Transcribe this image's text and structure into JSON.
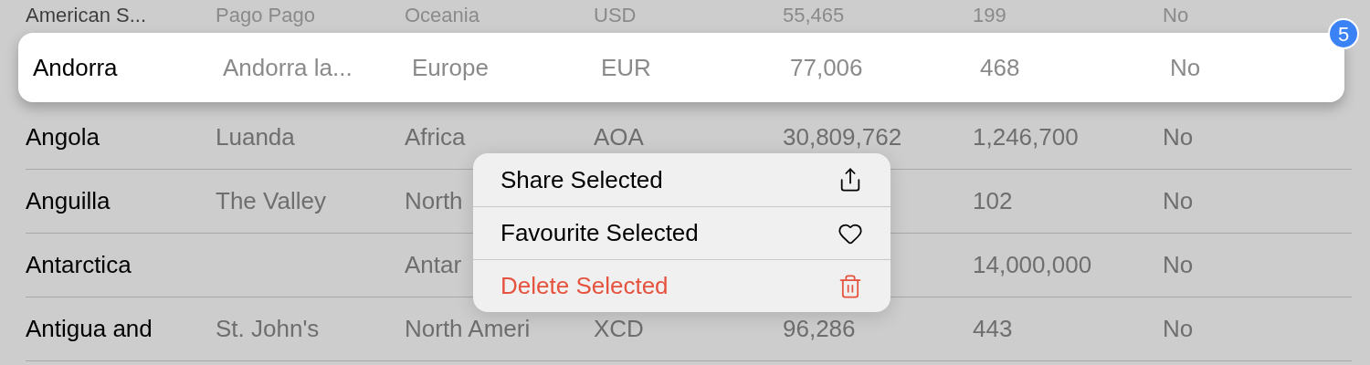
{
  "rows_above": [
    {
      "cells": [
        "American S...",
        "Pago Pago",
        "Oceania",
        "USD",
        "55,465",
        "199",
        "No"
      ]
    }
  ],
  "dragged_row": {
    "cells": [
      "Andorra",
      "Andorra la...",
      "Europe",
      "EUR",
      "77,006",
      "468",
      "No"
    ],
    "badge": "5"
  },
  "rows": [
    {
      "cells": [
        "Angola",
        "Luanda",
        "Africa",
        "AOA",
        "30,809,762",
        "1,246,700",
        "No"
      ]
    },
    {
      "cells": [
        "Anguilla",
        "The Valley",
        "North",
        null,
        null,
        "102",
        "No"
      ]
    },
    {
      "cells": [
        "Antarctica",
        null,
        "Antar",
        null,
        null,
        "14,000,000",
        "No"
      ]
    },
    {
      "cells": [
        "Antigua and",
        "St. John's",
        "North Ameri",
        "XCD",
        "96,286",
        "443",
        "No"
      ]
    }
  ],
  "context_menu": {
    "items": [
      {
        "label": "Share Selected",
        "kind": "share"
      },
      {
        "label": "Favourite Selected",
        "kind": "favourite"
      },
      {
        "label": "Delete Selected",
        "kind": "delete"
      }
    ]
  }
}
